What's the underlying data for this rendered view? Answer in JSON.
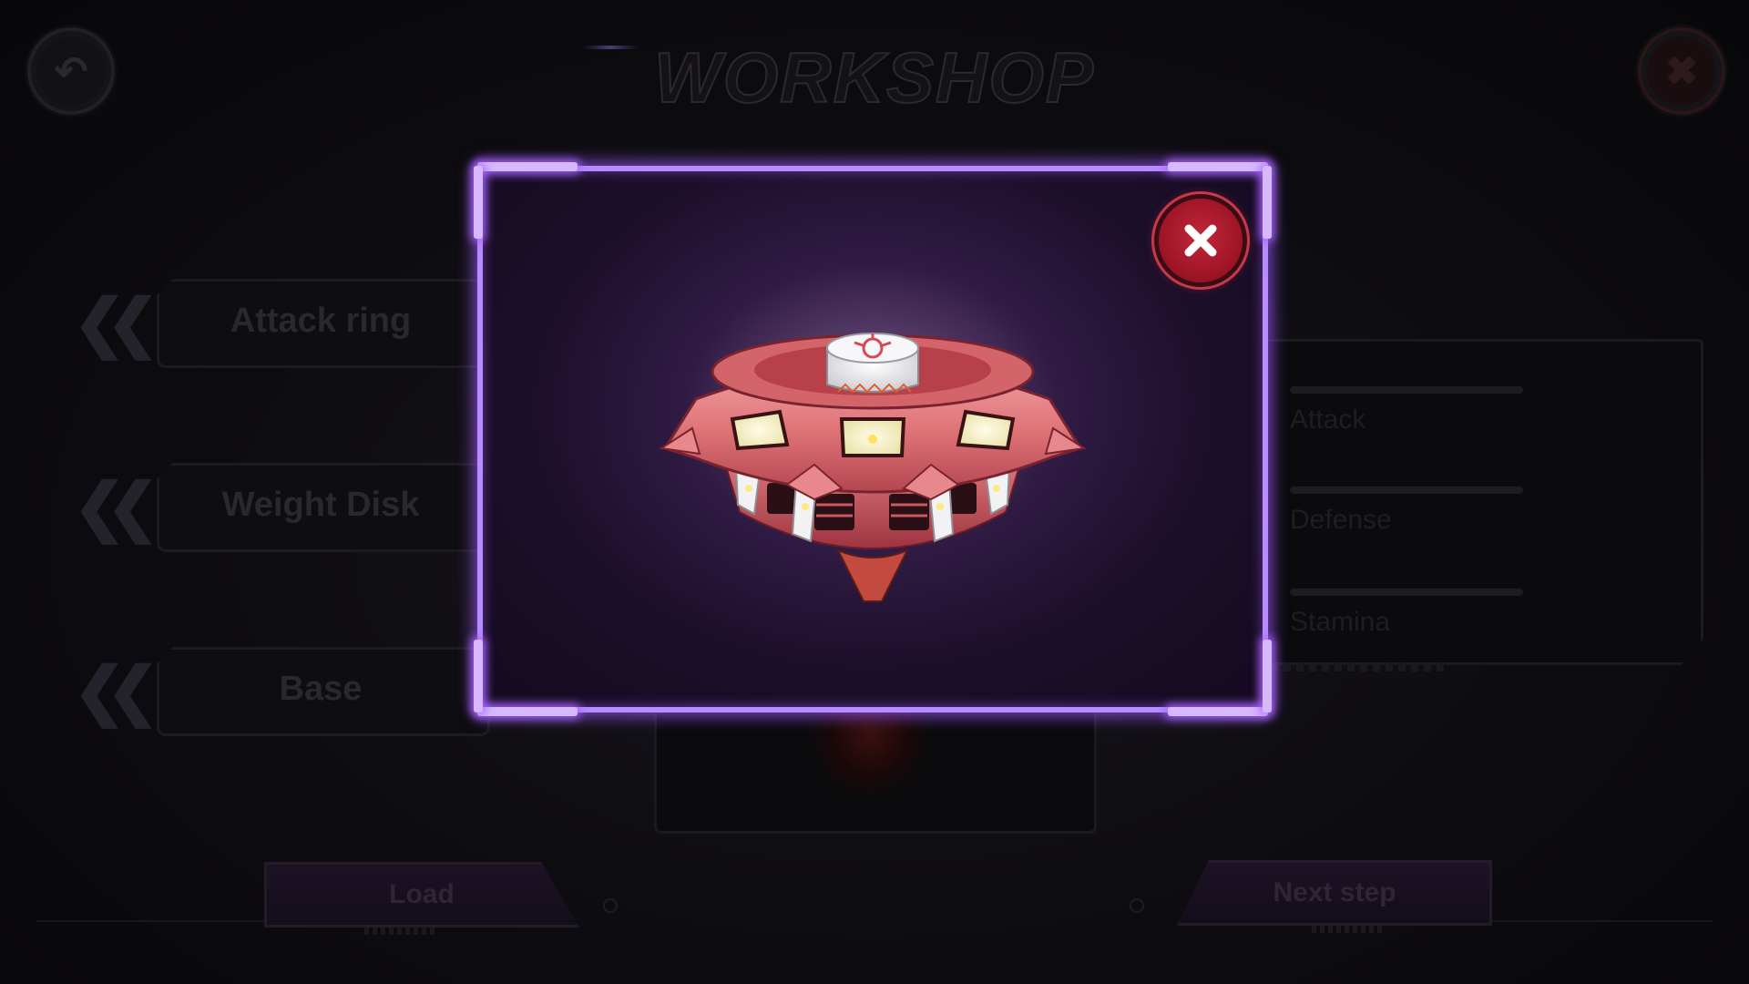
{
  "screen": {
    "title": "WORKSHOP"
  },
  "header": {
    "back_icon": "back-arrow-icon",
    "close_icon": "close-x-icon"
  },
  "parts": [
    {
      "label": "Attack ring",
      "icon": "double-chevron-left-icon"
    },
    {
      "label": "Weight Disk",
      "icon": "double-chevron-left-icon"
    },
    {
      "label": "Base",
      "icon": "double-chevron-left-icon"
    }
  ],
  "stats": [
    {
      "label": "Attack"
    },
    {
      "label": "Defense"
    },
    {
      "label": "Stamina"
    }
  ],
  "footer": {
    "load_label": "Load",
    "next_label": "Next step"
  },
  "modal": {
    "close_icon": "close-x-icon",
    "preview_subject": "spinning-top-model",
    "frame_color": "#b68cff",
    "accent_color": "#c2273a",
    "top_color": "#e07a7e"
  }
}
